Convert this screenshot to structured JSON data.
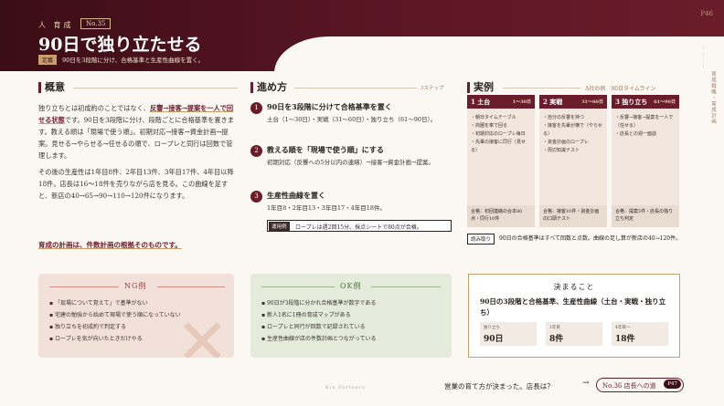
{
  "header": {
    "kicker": "人 育成",
    "number": "No.35",
    "title": "90日で独り立たせる",
    "def_tag": "定義",
    "def_text": "90日を3段階に分け、合格基準と生産性曲線を置く。",
    "page": "P46"
  },
  "side": {
    "vertical": "育成戦略・育成計画",
    "dash": "— — — —"
  },
  "gaiyo": {
    "heading": "概意",
    "p1_a": "独り立ちとは初成約のことではなく、",
    "p1_ul": "反響→接客→提案を一人で回せる状態",
    "p1_b": "です。90日を3段階に分け、段階ごとに合格基準を置きます。教える順は「現場で使う順」。初期対応→接客→資金計画→提案。見せる→やらせる→任せるの順で、ロープレと同行は回数で管理します。",
    "p2": "その後の生産性は1年目8件、2年目13件、3年目17件、4年目以降18件。店長は16〜18件を売りながら店を見る。この曲線を足すと、新店の40→65→90→110→120件になります。",
    "emph": "育成の計画は、件数計画の根拠そのものです。"
  },
  "susumekata": {
    "heading": "進め方",
    "label": "3ステップ",
    "steps": [
      {
        "n": "1",
        "title": "90日を3段階に分けて合格基準を置く",
        "desc": "土台（1〜30日）・実戦（31〜60日）・独り立ち（61〜90日）。"
      },
      {
        "n": "2",
        "title": "教える順を「現場で使う順」にする",
        "desc": "初期対応（反響への5分以内の連絡）→接客→資金計画→提案。"
      },
      {
        "n": "3",
        "title": "生産性曲線を置く",
        "desc": "1年目8・2年目13・3年目17・4年目18件。"
      }
    ],
    "ex_tag": "運用例",
    "ex_text": "ロープレは週2回15分。採点シートで80点が合格。"
  },
  "jitsurei": {
    "heading": "実例",
    "sub": "A社の例　90日タイムライン",
    "cols": [
      {
        "title": "1 土台",
        "days": "1〜30日",
        "items": [
          "・朝日タイムテーブル",
          "・商圏を車で回る",
          "・初期対応のロープレ毎日",
          "・先輩の接客に同行（見せる）"
        ],
        "foot": "合格：初回連絡の台本80点・同行10件"
      },
      {
        "title": "2 実戦",
        "days": "31〜60日",
        "items": [
          "・自分の反響を持つ",
          "・接客を先輩が横で（やらせる）",
          "・資金計画のロープレ",
          "・周辺知識テスト"
        ],
        "foot": "合格：接客10件・資金計画の口頭テスト"
      },
      {
        "title": "3 独り立ち",
        "days": "61〜90日",
        "items": [
          "・反響→接客→提案を一人で（任せる）",
          "・店長との週一面談"
        ],
        "foot": "合格：提案5件・店長の独り立ち判定"
      }
    ],
    "rd_tag": "読み取り",
    "rd_text": "90日の合格基準はすべて回数と点数。曲線の足し算が新店の40→120件。"
  },
  "ng": {
    "heading": "NG例",
    "items": [
      "「现場について覚えて」で基準がない",
      "宅建の勉強から始めて現場で使う順になっていない",
      "独り立ちを初成約で判定する",
      "ロープレを気が向いたときだけやる"
    ]
  },
  "ok": {
    "heading": "OK例",
    "items": [
      "90日が3段階に分かれ合格基準が数字である",
      "新人1名に1冊の育成マップがある",
      "ロープレと同行が回数で記録されている",
      "生産性曲線が店の件数計画とつながっている"
    ]
  },
  "decide": {
    "heading": "決まること",
    "text": "90日の3段階と合格基準、生産性曲線（土台・実戦・独り立ち）",
    "kpis": [
      {
        "label": "独り立ち",
        "value": "90日"
      },
      {
        "label": "1年目",
        "value": "8件"
      },
      {
        "label": "4年目〜",
        "value": "18件"
      }
    ]
  },
  "footer": {
    "question": "営業の育て方が決まった。店長は？",
    "arrow": "→",
    "next": "No.36 店長への道",
    "next_page": "P47",
    "brand": "Kin Partners"
  },
  "colors": {
    "accent": "#6b1c2b",
    "gold": "#c9a06a"
  }
}
